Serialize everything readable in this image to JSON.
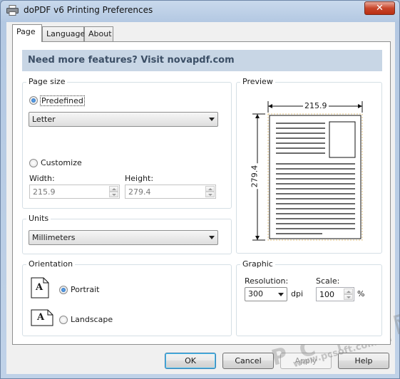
{
  "window": {
    "title": "doPDF v6 Printing Preferences",
    "close_label": "✕"
  },
  "tabs": [
    {
      "label": "Page",
      "active": true
    },
    {
      "label": "Language",
      "active": false
    },
    {
      "label": "About",
      "active": false
    }
  ],
  "banner": {
    "text": "Need more features? Visit novapdf.com"
  },
  "page_size": {
    "group_label": "Page size",
    "predefined_label": "Predefined",
    "predefined_checked": true,
    "predefined_value": "Letter",
    "customize_label": "Customize",
    "width_label": "Width:",
    "width_value": "215.9",
    "height_label": "Height:",
    "height_value": "279.4"
  },
  "units": {
    "group_label": "Units",
    "value": "Millimeters"
  },
  "orientation": {
    "group_label": "Orientation",
    "portrait_label": "Portrait",
    "portrait_checked": true,
    "landscape_label": "Landscape",
    "icon_letter": "A"
  },
  "preview": {
    "group_label": "Preview",
    "width_dim": "215.9",
    "height_dim": "279.4"
  },
  "graphic": {
    "group_label": "Graphic",
    "resolution_label": "Resolution:",
    "resolution_value": "300",
    "resolution_unit": "dpi",
    "scale_label": "Scale:",
    "scale_value": "100",
    "scale_unit": "%"
  },
  "buttons": {
    "ok": "OK",
    "cancel": "Cancel",
    "apply": "Apply",
    "help": "Help"
  },
  "watermark": {
    "main": "P C 下 载 网",
    "url": "www.pcsoft.com.cn"
  }
}
